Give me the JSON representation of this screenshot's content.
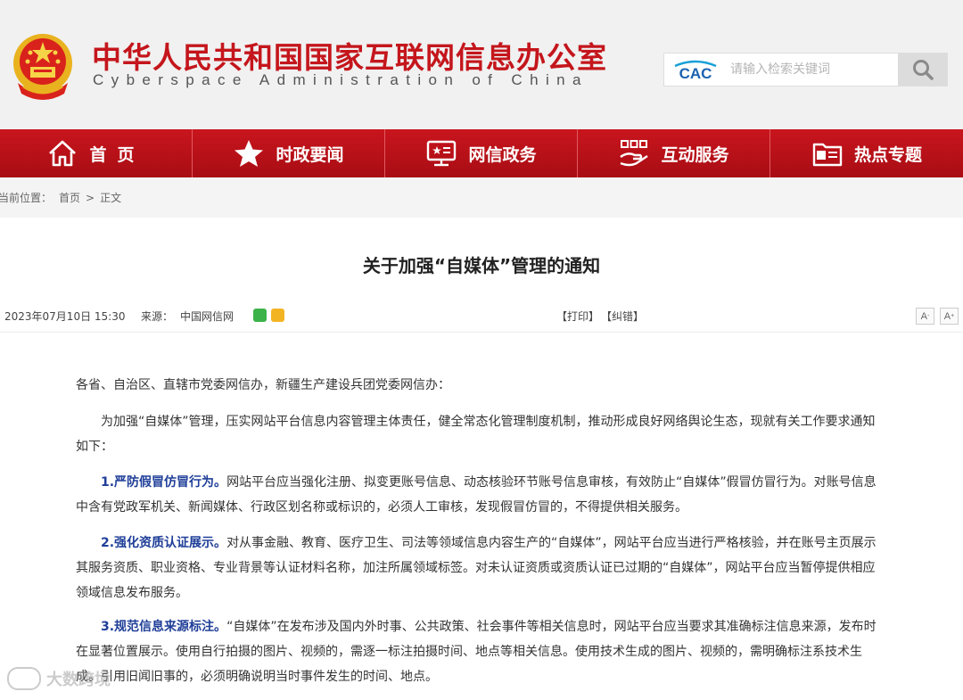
{
  "header": {
    "title": "中华人民共和国国家互联网信息办公室",
    "subtitle": "Cyberspace Administration of China",
    "search_logo": "CAC",
    "search_placeholder": "请输入检索关键词"
  },
  "nav": {
    "items": [
      {
        "label": "首页",
        "icon": "home-icon"
      },
      {
        "label": "时政要闻",
        "icon": "star-icon"
      },
      {
        "label": "网信政务",
        "icon": "monitor-icon"
      },
      {
        "label": "互动服务",
        "icon": "handshake-icon"
      },
      {
        "label": "热点专题",
        "icon": "folder-icon"
      }
    ]
  },
  "breadcrumb": {
    "label": "当前位置：",
    "home": "首页",
    "separator": ">",
    "current": "正文"
  },
  "article": {
    "title": "关于加强“自媒体”管理的通知",
    "date": "2023年07月10日 15:30",
    "source_label": "来源：",
    "source": "中国网信网",
    "print": "【打印】",
    "correct": "【纠错】",
    "font_smaller": "A",
    "font_larger": "A",
    "salutation": "各省、自治区、直辖市党委网信办，新疆生产建设兵团党委网信办：",
    "intro": "为加强“自媒体”管理，压实网站平台信息内容管理主体责任，健全常态化管理制度机制，推动形成良好网络舆论生态，现就有关工作要求通知如下：",
    "sections": [
      {
        "lead": "1.严防假冒仿冒行为。",
        "text": "网站平台应当强化注册、拟变更账号信息、动态核验环节账号信息审核，有效防止“自媒体”假冒仿冒行为。对账号信息中含有党政军机关、新闻媒体、行政区划名称或标识的，必须人工审核，发现假冒仿冒的，不得提供相关服务。"
      },
      {
        "lead": "2.强化资质认证展示。",
        "text": "对从事金融、教育、医疗卫生、司法等领域信息内容生产的“自媒体”，网站平台应当进行严格核验，并在账号主页展示其服务资质、职业资格、专业背景等认证材料名称，加注所属领域标签。对未认证资质或资质认证已过期的“自媒体”，网站平台应当暂停提供相应领域信息发布服务。"
      },
      {
        "lead": "3.规范信息来源标注。",
        "text": "“自媒体”在发布涉及国内外时事、公共政策、社会事件等相关信息时，网站平台应当要求其准确标注信息来源，发布时在显著位置展示。使用自行拍摄的图片、视频的，需逐一标注拍摄时间、地点等相关信息。使用技术生成的图片、视频的，需明确标注系技术生成。引用旧闻旧事的，必须明确说明当时事件发生的时间、地点。"
      }
    ]
  },
  "watermark": "大数跨境",
  "colors": {
    "brand_red": "#c4161c",
    "nav_red": "#b3111a",
    "lead_blue": "#1f3e98"
  }
}
